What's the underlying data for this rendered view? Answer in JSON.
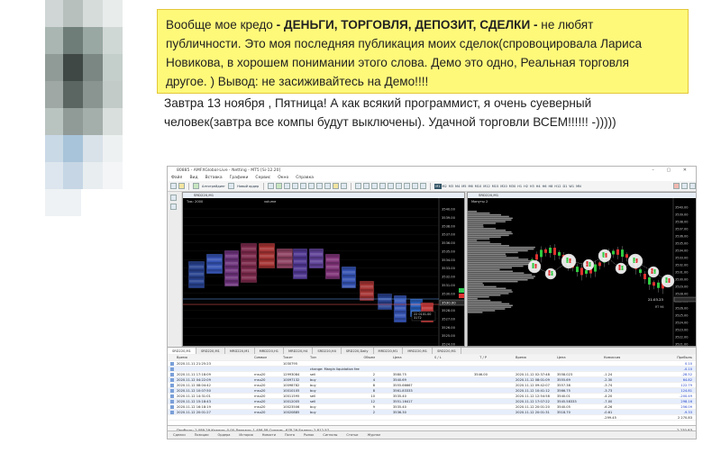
{
  "post": {
    "highlight_line1": "Вообще мое кредо ",
    "highlight_bold": "- ДЕНЬГИ, ТОРГОВЛЯ, ДЕПОЗИТ, СДЕЛКИ -",
    "highlight_line1_end": " не любят",
    "highlight_line2": "публичности. Это моя последняя публикация моих сделок(спровоцировала Лариса",
    "highlight_line3": "Новикова, в хорошем понимании этого слова. Демо это одно, Реальная торговля",
    "highlight_line4": "другое. ) Вывод: не засиживайтесь на Демо!!!!",
    "text_line1": "Завтра 13 ноября , Пятница! А как всякий программист, я очень суеверный",
    "text_line2": "человек(завтра все компы будут выключены). Удачной торговли ВСЕМ!!!!!!  -)))))"
  },
  "terminal": {
    "title": "80885 - AMFXGlobal-Live - Netting - MT5  [Si-12.20]",
    "menu": [
      "Файл",
      "Вид",
      "Вставка",
      "Графики",
      "Сервис",
      "Окно",
      "Справка"
    ],
    "toolbar": {
      "algo_label": "Алготрейдинг",
      "new_order_label": "Новый ордер",
      "timeframes": [
        "M1",
        "M2",
        "M3",
        "M4",
        "M5",
        "M6",
        "M10",
        "M12",
        "M15",
        "M20",
        "M30",
        "H1",
        "H2",
        "H3",
        "H4",
        "H6",
        "H8",
        "H12",
        "D1",
        "W1",
        "MN"
      ],
      "active_timeframe": "M1"
    },
    "left_chart": {
      "title": "SRD220,M1",
      "header_label": "Тик: 2000",
      "volume_label": "volume",
      "price_labels": [
        "3540.00",
        "3539.00",
        "3538.00",
        "3537.00",
        "3536.00",
        "3535.00",
        "3534.00",
        "3533.00",
        "3532.00",
        "3531.00",
        "3530.00",
        "3529.00",
        "3528.00",
        "3527.00",
        "3526.00",
        "3525.00",
        "3524.00"
      ],
      "current_price": "3530.00",
      "info_box": "22 0101.00\n3172"
    },
    "right_chart": {
      "title": "SRD220,M1",
      "header_label": "Минуты 2",
      "price_labels": [
        "3540.00",
        "3539.00",
        "3538.00",
        "3537.00",
        "3536.00",
        "3535.00",
        "3534.00",
        "3533.00",
        "3532.00",
        "3531.00",
        "3530.00",
        "3529.00",
        "3528.00",
        "3527.00",
        "3526.00",
        "3525.00",
        "3524.00",
        "3523.00",
        "3522.00",
        "3521.00"
      ],
      "time_label": "21.03.23",
      "sub_label": "RT 96"
    },
    "chart_tabs": [
      "SRD220,M1",
      "SRD220,M1",
      "MRD220,M1",
      "MRD220,H1",
      "MRD220,H4",
      "SRD220,H4",
      "SRD220,Daily",
      "MRD220,M1",
      "MRD220,M1",
      "SRD220,M1"
    ],
    "table": {
      "headers": {
        "time": "Время",
        "symbol": "Символ",
        "ticket": "Тикет",
        "type": "Тип",
        "volume": "Объем",
        "price": "Цена",
        "sl": "S / L",
        "tp": "T / P",
        "time2": "Время",
        "price2": "Цена",
        "commission": "Комиссия",
        "profit": "Прибыль"
      },
      "rows": [
        {
          "time": "2020.11.11 21:25:23",
          "symbol": "",
          "ticket": "1030795",
          "type": "",
          "volume": "",
          "price": "",
          "sl": "",
          "tp": "",
          "time2": "",
          "price2": "",
          "commission": "",
          "profit": "0.10"
        },
        {
          "time": "",
          "symbol": "",
          "ticket": "",
          "type": "change: Margin liquidation fee",
          "volume": "",
          "price": "",
          "sl": "",
          "tp": "",
          "time2": "",
          "price2": "",
          "commission": "",
          "profit": "-0.10"
        },
        {
          "time": "2020.11.11 17:18:09",
          "symbol": "rnsu20",
          "ticket": "12993084",
          "type": "sell",
          "volume": "2",
          "price": "3580.75",
          "sl": "",
          "tp": "3546.00",
          "time2": "2020.11.12 02:37:48",
          "price2": "3558.023",
          "commission": "-1.24",
          "profit": "-28.52"
        },
        {
          "time": "2020.11.12 04:22:09",
          "symbol": "rnsu20",
          "ticket": "10097132",
          "type": "buy",
          "volume": "4",
          "price": "3540.69",
          "sl": "",
          "tp": "",
          "time2": "2020.11.12 08:01:09",
          "price2": "3555.69",
          "commission": "-2.30",
          "profit": "64.82"
        },
        {
          "time": "2020.11.12 08:04:42",
          "symbol": "rnsu20",
          "ticket": "10098782",
          "type": "buy",
          "volume": "8",
          "price": "3555.66667",
          "sl": "",
          "tp": "",
          "time2": "2020.11.12 09:42:07",
          "price2": "3557.38",
          "commission": "-3.74",
          "profit": "122.79"
        },
        {
          "time": "2020.11.12 10:07:50",
          "symbol": "rnsu20",
          "ticket": "10010105",
          "type": "buy",
          "volume": "8",
          "price": "3561.83333",
          "sl": "",
          "tp": "",
          "time2": "2020.11.12 10:41:12",
          "price2": "3566.75",
          "commission": "-3.73",
          "profit": "124.81"
        },
        {
          "time": "2020.11.12 14:31:01",
          "symbol": "rnsu20",
          "ticket": "10011595",
          "type": "sell",
          "volume": "10",
          "price": "3535.40",
          "sl": "",
          "tp": "",
          "time2": "2020.11.12 12:54:58",
          "price2": "3540.01",
          "commission": "-4.20",
          "profit": "-200.49"
        },
        {
          "time": "2020.11.12 15:18:43",
          "symbol": "rnsu20",
          "ticket": "10012005",
          "type": "sell",
          "volume": "12",
          "price": "3551.16417",
          "sl": "",
          "tp": "",
          "time2": "2020.11.12 17:07:22",
          "price2": "3545.58333",
          "commission": "-7.00",
          "profit": "298.16"
        },
        {
          "time": "2020.11.12 16:18:19",
          "symbol": "rnsu20",
          "ticket": "10023506",
          "type": "buy",
          "volume": "9",
          "price": "3535.40",
          "sl": "",
          "tp": "",
          "time2": "2020.11.12 20:01:20",
          "price2": "3540.05",
          "commission": "-6.26",
          "profit": "256.09"
        },
        {
          "time": "2020.11.12 20:01:27",
          "symbol": "rnsu20",
          "ticket": "10020885",
          "type": "buy",
          "volume": "2",
          "price": "3536.30",
          "sl": "",
          "tp": "",
          "time2": "2020.11.12 20:01:31",
          "price2": "3518.70",
          "commission": "-0.61",
          "profit": "-9.33"
        }
      ],
      "totals": {
        "commission": "-299.45",
        "profit": "2 270.83"
      },
      "balance_line": "Прибыль: 2 089.29  Кредит: 0.00  Депозит: 1 486.58  Снятие: -678.29  Баланс: 2 812.57"
    },
    "bottom_tabs": [
      "Сделки",
      "Позиции",
      "Ордера",
      "История",
      "Новости",
      "Почта",
      "Рынок",
      "Сигналы",
      "Статьи",
      "Журнал"
    ]
  }
}
